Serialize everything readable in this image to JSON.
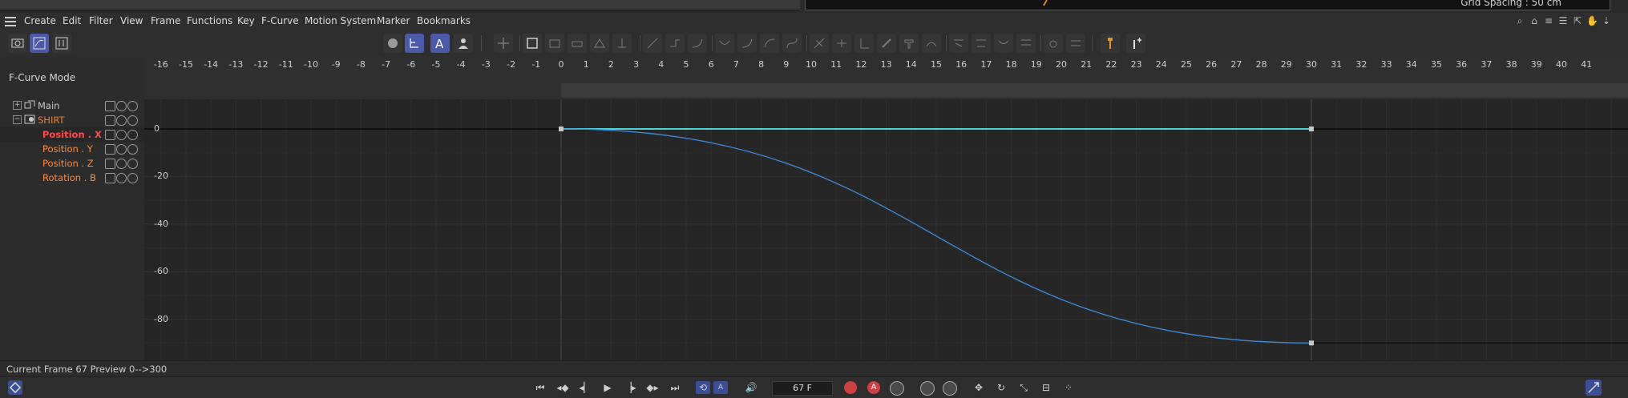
{
  "top": {
    "grid_spacing": "Grid Spacing : 50 cm"
  },
  "menu": {
    "items": [
      "Create",
      "Edit",
      "Filter",
      "View",
      "Frame",
      "Functions",
      "Key",
      "F-Curve",
      "Motion System",
      "Marker",
      "Bookmarks"
    ]
  },
  "left_panel": {
    "mode_label": "F-Curve Mode",
    "tree": [
      {
        "label": "Main",
        "color": "#d0d0d0"
      },
      {
        "label": "SHIRT",
        "color": "#e0803a"
      },
      {
        "label": "Position . X",
        "color": "#ff4a4a"
      },
      {
        "label": "Position . Y",
        "color": "#ff8a3a"
      },
      {
        "label": "Position . Z",
        "color": "#ff8a3a"
      },
      {
        "label": "Rotation . B",
        "color": "#ff8a3a"
      }
    ]
  },
  "ruler": {
    "ticks": [
      "-16",
      "-15",
      "-14",
      "-13",
      "-12",
      "-11",
      "-10",
      "-9",
      "-8",
      "-7",
      "-6",
      "-5",
      "-4",
      "-3",
      "-2",
      "-1",
      "0",
      "1",
      "2",
      "3",
      "4",
      "5",
      "6",
      "7",
      "8",
      "9",
      "10",
      "11",
      "12",
      "13",
      "14",
      "15",
      "16",
      "17",
      "18",
      "19",
      "20",
      "21",
      "22",
      "23",
      "24",
      "25",
      "26",
      "27",
      "28",
      "29",
      "30",
      "31",
      "32",
      "33",
      "34",
      "35",
      "36",
      "37",
      "38",
      "39",
      "40",
      "41"
    ]
  },
  "graph": {
    "y_labels": [
      "0",
      "-20",
      "-40",
      "-60",
      "-80"
    ],
    "curves": [
      {
        "name": "Position . X",
        "color": "#4fd2d6",
        "keys": [
          [
            0,
            0
          ],
          [
            30,
            0
          ]
        ]
      },
      {
        "name": "Rotation . B",
        "color": "#3d8be0",
        "keys": [
          [
            0,
            0
          ],
          [
            30,
            -90
          ]
        ]
      }
    ]
  },
  "status": {
    "text": "Current Frame   67   Preview    0-->300"
  },
  "transport": {
    "frame_value": "67 F"
  }
}
